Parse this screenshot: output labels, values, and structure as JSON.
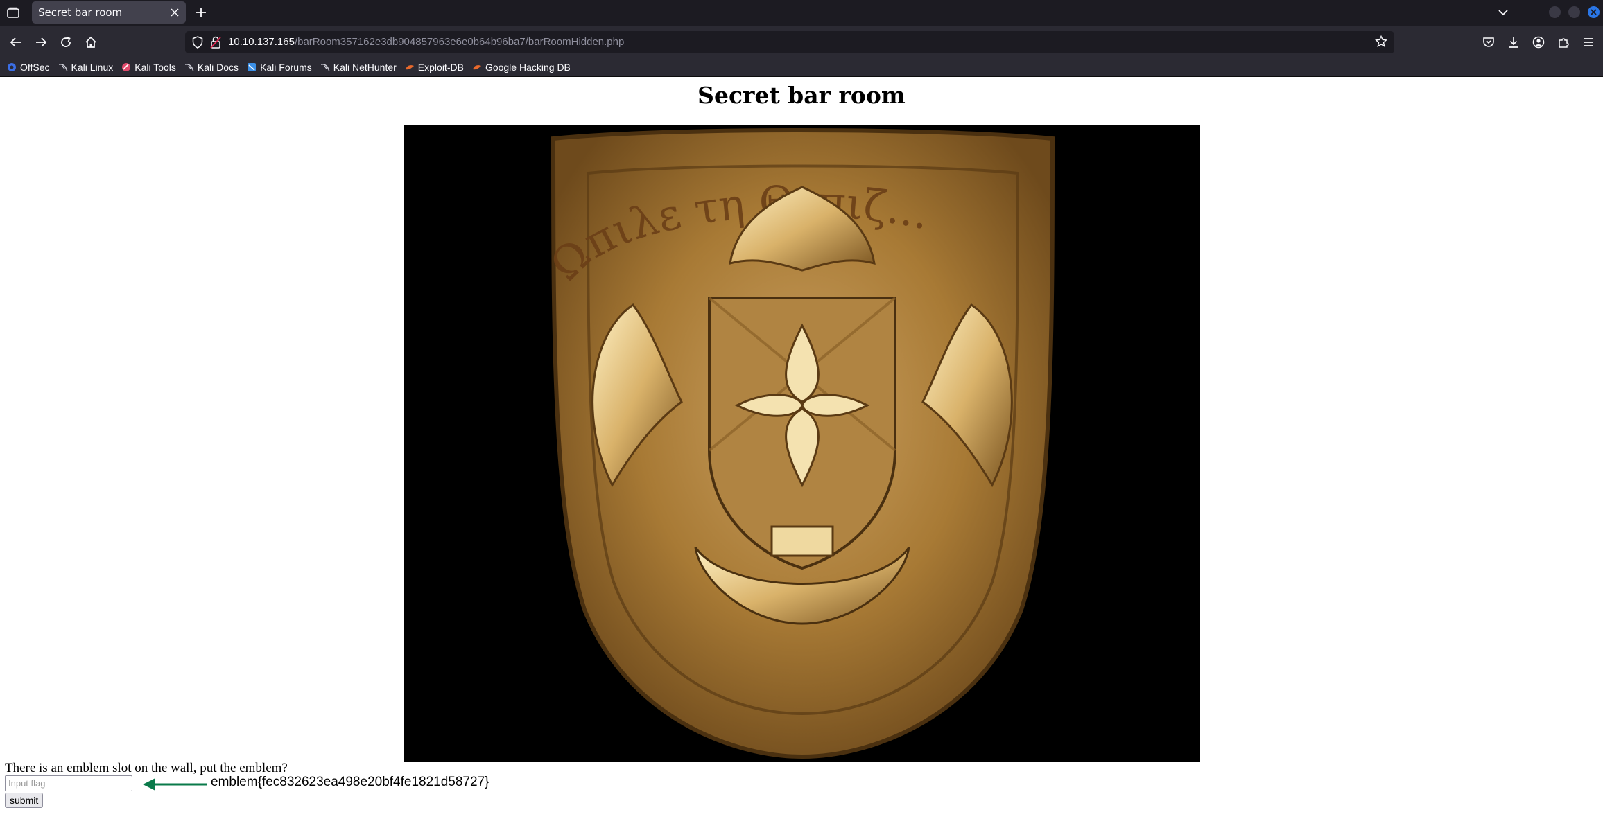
{
  "browser": {
    "tab_title": "Secret bar room",
    "url_host": "10.10.137.165",
    "url_path": "/barRoom357162e3db904857963e6e0b64b96ba7/barRoomHidden.php"
  },
  "bookmarks": [
    {
      "label": "OffSec",
      "icon": "offsec-icon",
      "color": "#3b6ee6"
    },
    {
      "label": "Kali Linux",
      "icon": "kali-dragon-icon",
      "color": "#cfcfd8"
    },
    {
      "label": "Kali Tools",
      "icon": "kali-tools-icon",
      "color": "#e14a6c"
    },
    {
      "label": "Kali Docs",
      "icon": "kali-dragon-icon",
      "color": "#cfcfd8"
    },
    {
      "label": "Kali Forums",
      "icon": "kali-forums-icon",
      "color": "#3b8fe6"
    },
    {
      "label": "Kali NetHunter",
      "icon": "kali-dragon-icon",
      "color": "#cfcfd8"
    },
    {
      "label": "Exploit-DB",
      "icon": "exploit-db-icon",
      "color": "#e8692c"
    },
    {
      "label": "Google Hacking DB",
      "icon": "ghdb-icon",
      "color": "#e8692c"
    }
  ],
  "page": {
    "heading": "Secret bar room",
    "emblem_inscription": "Ωπιλε τη Θεπιζ...",
    "prompt": "There is an emblem slot on the wall, put the emblem?",
    "input_placeholder": "Input flag",
    "submit_label": "submit",
    "annotation_text": "emblem{fec832623ea498e20bf4fe1821d58727}",
    "annotation_arrow_color": "#0a7a4a"
  },
  "colors": {
    "chrome_dark": "#1c1b22",
    "chrome_toolbar": "#2b2a33",
    "tab_active": "#42414d",
    "accent_blue": "#2a76e6"
  }
}
